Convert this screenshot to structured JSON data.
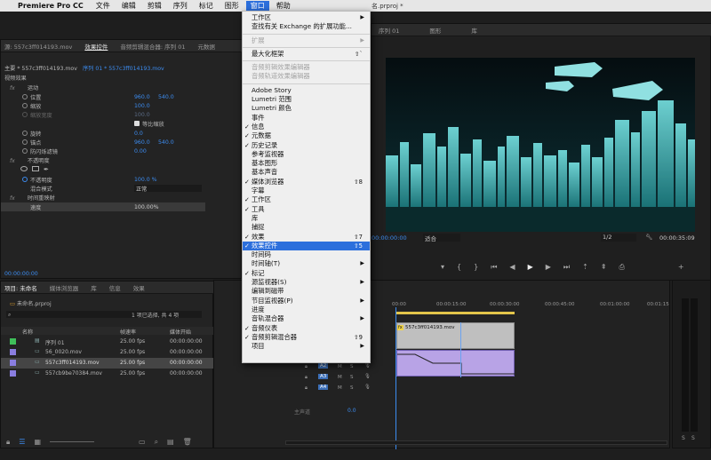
{
  "menubar": {
    "app_name": "Premiere Pro CC",
    "items": [
      "文件",
      "编辑",
      "剪辑",
      "序列",
      "标记",
      "图形"
    ],
    "active_item": "窗口",
    "help": "帮助",
    "doc_title_fragment": "名.prproj *"
  },
  "window_menu": {
    "items": [
      {
        "label": "工作区",
        "arrow": "▶",
        "checked": false
      },
      {
        "label": "查找有关 Exchange 的扩展功能...",
        "checked": false
      },
      {
        "sep": true
      },
      {
        "label": "扩展",
        "arrow": "▶",
        "disabled": true
      },
      {
        "sep": true
      },
      {
        "label": "最大化框架",
        "shortcut": "⇧`"
      },
      {
        "sep": true
      },
      {
        "label": "音频剪辑效果编辑器",
        "disabled": true
      },
      {
        "label": "音频轨道效果编辑器",
        "disabled": true
      },
      {
        "sep": true
      },
      {
        "label": "Adobe Story"
      },
      {
        "label": "Lumetri 范围"
      },
      {
        "label": "Lumetri 颜色"
      },
      {
        "label": "事件"
      },
      {
        "label": "信息",
        "checked": true
      },
      {
        "label": "元数据",
        "checked": true
      },
      {
        "label": "历史记录",
        "checked": true
      },
      {
        "label": "参考监视器"
      },
      {
        "label": "基本图形"
      },
      {
        "label": "基本声音"
      },
      {
        "label": "媒体浏览器",
        "checked": true,
        "shortcut": "⇧8"
      },
      {
        "label": "字幕"
      },
      {
        "label": "工作区",
        "checked": true
      },
      {
        "label": "工具",
        "checked": true
      },
      {
        "label": "库"
      },
      {
        "label": "捕捉"
      },
      {
        "label": "效果",
        "checked": true,
        "shortcut": "⇧7"
      },
      {
        "label": "效果控件",
        "checked": true,
        "shortcut": "⇧5",
        "highlighted": true
      },
      {
        "label": "时间码"
      },
      {
        "label": "时间轴(T)",
        "arrow": "▶"
      },
      {
        "label": "标记",
        "checked": true
      },
      {
        "label": "源监视器(S)",
        "arrow": "▶"
      },
      {
        "label": "编辑到磁带"
      },
      {
        "label": "节目监视器(P)",
        "arrow": "▶"
      },
      {
        "label": "进度"
      },
      {
        "label": "音轨混合器",
        "arrow": "▶"
      },
      {
        "label": "音频仪表",
        "checked": true
      },
      {
        "label": "音频剪辑混合器",
        "checked": true,
        "shortcut": "⇧9"
      },
      {
        "label": "项目",
        "arrow": "▶"
      }
    ]
  },
  "source_panel": {
    "tabs": [
      "源: 557c3ff014193.mov",
      "效果控件",
      "音频剪辑混合器: 序列 01",
      "元数据"
    ],
    "active_tab": "效果控件",
    "master_label": "主要 * 557c3ff014193.mov",
    "sequence_label": "序列 01 * 557c3ff014193.mov",
    "section_video": "视频效果",
    "motion": "运动",
    "rows": [
      {
        "label": "位置",
        "v1": "960.0",
        "v2": "540.0"
      },
      {
        "label": "缩放",
        "v1": "100.0",
        "v2": ""
      },
      {
        "label": "缩放宽度",
        "v1": "100.0",
        "v2": "",
        "disabled": true
      },
      {
        "label": "等比缩放",
        "v1": "",
        "v2": "",
        "checkbox": true
      },
      {
        "label": "旋转",
        "v1": "0.0",
        "v2": ""
      },
      {
        "label": "锚点",
        "v1": "960.0",
        "v2": "540.0"
      },
      {
        "label": "防闪烁滤镜",
        "v1": "0.00",
        "v2": ""
      }
    ],
    "opacity": "不透明度",
    "opacity_value": "100.0 %",
    "blend_label": "混合模式",
    "blend_value": "正常",
    "time_remap": "时间重映射",
    "speed_label": "速度",
    "speed_value": "100.00%",
    "timecode": "00:00:00:00"
  },
  "project_panel": {
    "tabs": [
      "项目: 未命名",
      "媒体浏览器",
      "库",
      "信息",
      "效果"
    ],
    "file": "未命名.prproj",
    "selection_info": "1 项已选择, 共 4 项",
    "columns": [
      "名称",
      "帧速率",
      "媒体开始"
    ],
    "items": [
      {
        "name": "序列 01",
        "fps": "25.00 fps",
        "start": "00:00:00:00",
        "color": "#3fbf5a",
        "selected": false
      },
      {
        "name": "56_0020.mov",
        "fps": "25.00 fps",
        "start": "00:00:00:00",
        "color": "#8a7ee0",
        "selected": false
      },
      {
        "name": "557c3ff014193.mov",
        "fps": "25.00 fps",
        "start": "00:00:00:00",
        "color": "#8a7ee0",
        "selected": true
      },
      {
        "name": "557cb9be70384.mov",
        "fps": "25.00 fps",
        "start": "00:00:00:00",
        "color": "#8a7ee0",
        "selected": false
      }
    ]
  },
  "program_monitor": {
    "tab1": "序列 01",
    "tabs": [
      "图形",
      "库"
    ],
    "timecode": "00:00:00:00",
    "fit": "适合",
    "quality": "1/2",
    "duration": "00:00:35:09"
  },
  "timeline": {
    "ruler": [
      "00:00",
      "00:00:15:00",
      "00:00:30:00",
      "00:00:45:00",
      "00:01:00:00",
      "00:01:15"
    ],
    "clip_name": "557c3ff014193.mov",
    "tracks": [
      "A1",
      "A2",
      "A3",
      "A4"
    ],
    "master": "主声道",
    "master_value": "0.0"
  },
  "meters": {
    "labels": [
      "S",
      "S"
    ]
  },
  "colors": {
    "accent": "#3c8cf0",
    "menu_highlight": "#2c6fdc",
    "video_clip": "#bfbfbf",
    "audio_clip": "#b8a3e6",
    "playhead": "#3c8cf0"
  }
}
